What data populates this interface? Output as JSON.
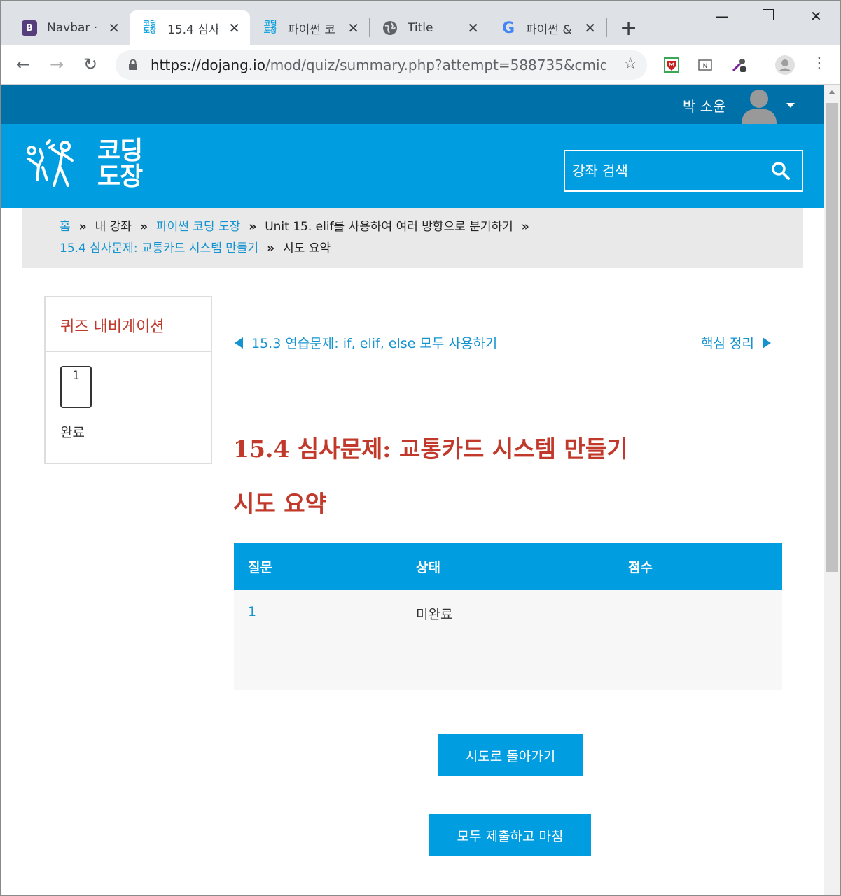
{
  "browser": {
    "tabs": [
      {
        "title": "Navbar ·",
        "favicon": "B",
        "active": false
      },
      {
        "title": "15.4 심사",
        "favicon": "코딩도장",
        "active": true
      },
      {
        "title": "파이썬 코",
        "favicon": "코딩도장",
        "active": false
      },
      {
        "title": "Title",
        "favicon": "globe-icon",
        "active": false
      },
      {
        "title": "파이썬 &",
        "favicon": "G",
        "active": false
      }
    ],
    "url_host": "https://dojang.io",
    "url_path": "/mod/quiz/summary.php?attempt=588735&cmid..."
  },
  "user": {
    "name": "박 소윤"
  },
  "header": {
    "logo_line1": "코딩",
    "logo_line2": "도장",
    "search_placeholder": "강좌 검색"
  },
  "breadcrumb": {
    "home": "홈",
    "my_courses": "내 강좌",
    "course": "파이썬 코딩 도장",
    "unit": "Unit 15. elif를 사용하여 여러 방향으로 분기하기",
    "quiz": "15.4 심사문제: 교통카드 시스템 만들기",
    "current": "시도 요약",
    "separator": "»"
  },
  "quiz_nav": {
    "title": "퀴즈 내비게이션",
    "question_number": "1",
    "finish_label": "완료"
  },
  "activity_nav": {
    "prev": "15.3 연습문제: if, elif, else 모두 사용하기",
    "next": "핵심 정리"
  },
  "main": {
    "title": "15.4 심사문제: 교통카드 시스템 만들기",
    "subtitle": "시도 요약"
  },
  "summary_table": {
    "headers": [
      "질문",
      "상태",
      "점수"
    ],
    "rows": [
      {
        "question": "1",
        "status": "미완료",
        "score": ""
      }
    ]
  },
  "buttons": {
    "return": "시도로 돌아가기",
    "submit": "모두 제출하고 마침"
  },
  "colors": {
    "brand": "#009de0",
    "userbar": "#0070a8",
    "heading": "#c0392b",
    "link": "#1493d0"
  }
}
